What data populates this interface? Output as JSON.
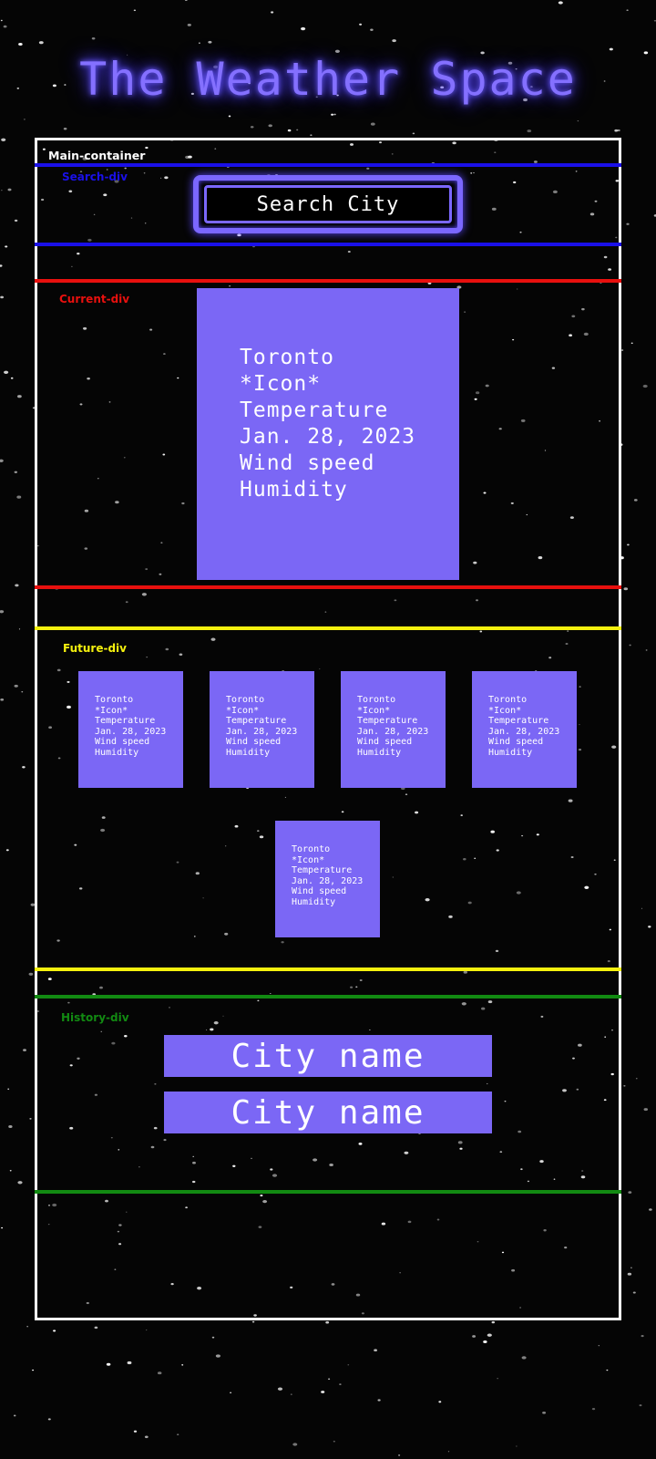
{
  "app": {
    "title": "The Weather Space",
    "accent_color": "#7b67f5",
    "glow_color": "#8470ff"
  },
  "labels": {
    "main_container": "Main-container",
    "search_div": "Search-div",
    "current_div": "Current-div",
    "future_div": "Future-div",
    "history_div": "History-div"
  },
  "label_colors": {
    "main_container": "#ffffff",
    "search_div": "#1a10e8",
    "current_div": "#e8100e",
    "future_div": "#f5f10e",
    "history_div": "#128a12"
  },
  "search": {
    "label": "Search City"
  },
  "current": {
    "city": "Toronto",
    "icon": "*Icon*",
    "temperature": "Temperature",
    "date": "Jan. 28, 2023",
    "wind": "Wind speed",
    "humidity": "Humidity"
  },
  "future": [
    {
      "city": "Toronto",
      "icon": "*Icon*",
      "temperature": "Temperature",
      "date": "Jan. 28, 2023",
      "wind": "Wind speed",
      "humidity": "Humidity"
    },
    {
      "city": "Toronto",
      "icon": "*Icon*",
      "temperature": "Temperature",
      "date": "Jan. 28, 2023",
      "wind": "Wind speed",
      "humidity": "Humidity"
    },
    {
      "city": "Toronto",
      "icon": "*Icon*",
      "temperature": "Temperature",
      "date": "Jan. 28, 2023",
      "wind": "Wind speed",
      "humidity": "Humidity"
    },
    {
      "city": "Toronto",
      "icon": "*Icon*",
      "temperature": "Temperature",
      "date": "Jan. 28, 2023",
      "wind": "Wind speed",
      "humidity": "Humidity"
    },
    {
      "city": "Toronto",
      "icon": "*Icon*",
      "temperature": "Temperature",
      "date": "Jan. 28, 2023",
      "wind": "Wind speed",
      "humidity": "Humidity"
    }
  ],
  "history": [
    {
      "label": "City name"
    },
    {
      "label": "City name"
    }
  ]
}
